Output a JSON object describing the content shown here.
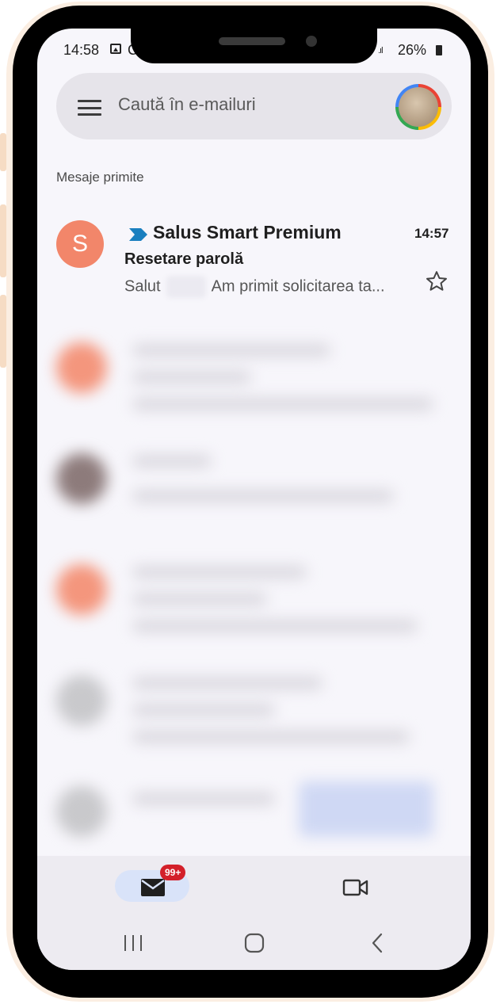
{
  "status_bar": {
    "time": "14:58",
    "extra": "C",
    "signal": ".ıl",
    "battery": "26%"
  },
  "search": {
    "placeholder": "Caută în e-mailuri"
  },
  "inbox": {
    "section_label": "Mesaje primite"
  },
  "email": {
    "sender_initial": "S",
    "sender": "Salus Smart Premium",
    "time": "14:57",
    "subject": "Resetare parolă",
    "preview_start": "Salut",
    "preview_end": "Am primit solicitarea ta...",
    "avatar_color": "#f2866a",
    "importance_color": "#1a7fbf"
  },
  "bottom_nav": {
    "mail_badge": "99+",
    "badge_color": "#d3202a"
  },
  "icons": [
    "menu-icon",
    "image-icon",
    "importance-marker-icon",
    "star-icon",
    "mail-icon",
    "video-camera-icon",
    "recent-apps-icon",
    "home-icon",
    "back-icon"
  ]
}
